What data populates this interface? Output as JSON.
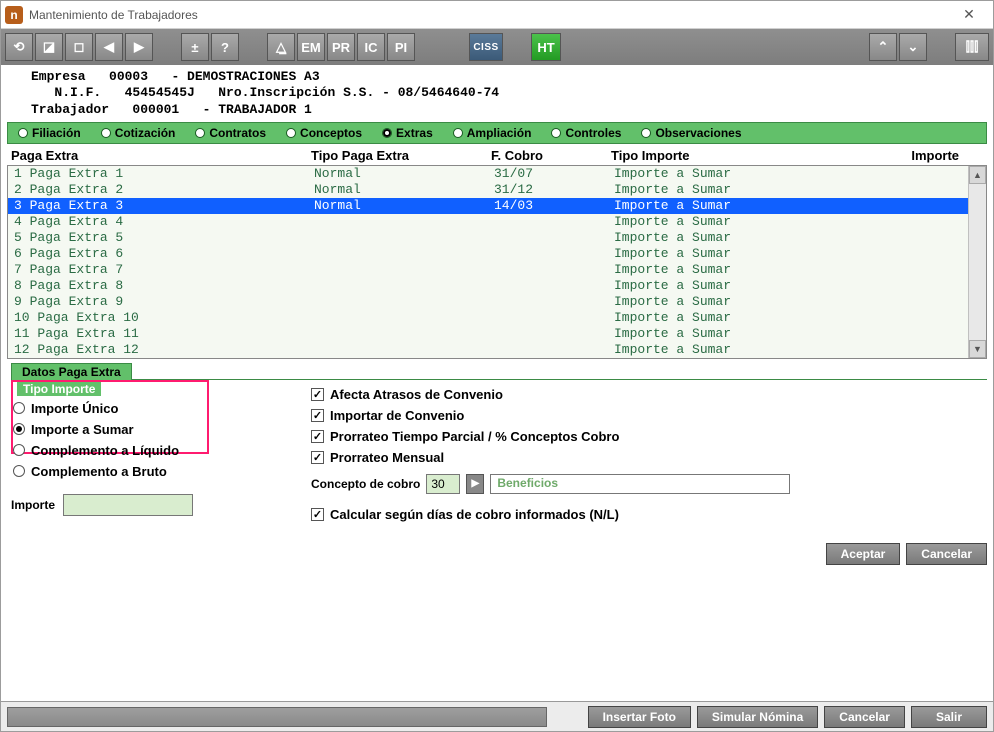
{
  "window": {
    "title": "Mantenimiento de Trabajadores",
    "app_icon_letter": "n"
  },
  "toolbar": {
    "refresh": "⟲",
    "max": "◪",
    "stop": "◻",
    "prev": "◀",
    "next": "▶",
    "plus": "±",
    "help": "?",
    "bell": "△̲",
    "em": "EM",
    "pr": "PR",
    "ic": "IC",
    "pi": "PI",
    "ciss": "CISS",
    "ht": "HT",
    "up": "⌃",
    "down": "⌄",
    "eq": "⫿⫿⫿"
  },
  "info": {
    "empresa_label": "Empresa",
    "empresa_code": "00003",
    "empresa_name": "- DEMOSTRACIONES A3",
    "nif_label": "N.I.F.",
    "nif": "45454545J",
    "inscrip_label": "Nro.Inscripción S.S.",
    "inscrip": "- 08/5464640-74",
    "trab_label": "Trabajador",
    "trab_code": "000001",
    "trab_name": "- TRABAJADOR 1"
  },
  "tabs": [
    "Filiación",
    "Cotización",
    "Contratos",
    "Conceptos",
    "Extras",
    "Ampliación",
    "Controles",
    "Observaciones"
  ],
  "active_tab": 4,
  "list_headers": [
    "Paga Extra",
    "Tipo Paga Extra",
    "F. Cobro",
    "Tipo Importe",
    "Importe"
  ],
  "rows": [
    {
      "n": "1",
      "name": "Paga Extra 1",
      "tipo": "Normal",
      "f": "31/07",
      "ti": "Importe a Sumar"
    },
    {
      "n": "2",
      "name": "Paga Extra 2",
      "tipo": "Normal",
      "f": "31/12",
      "ti": "Importe a Sumar"
    },
    {
      "n": "3",
      "name": "Paga Extra 3",
      "tipo": "Normal",
      "f": "14/03",
      "ti": "Importe a Sumar",
      "selected": true
    },
    {
      "n": "4",
      "name": "Paga Extra 4",
      "tipo": "",
      "f": "",
      "ti": "Importe a Sumar"
    },
    {
      "n": "5",
      "name": "Paga Extra 5",
      "tipo": "",
      "f": "",
      "ti": "Importe a Sumar"
    },
    {
      "n": "6",
      "name": "Paga Extra 6",
      "tipo": "",
      "f": "",
      "ti": "Importe a Sumar"
    },
    {
      "n": "7",
      "name": "Paga Extra 7",
      "tipo": "",
      "f": "",
      "ti": "Importe a Sumar"
    },
    {
      "n": "8",
      "name": "Paga Extra 8",
      "tipo": "",
      "f": "",
      "ti": "Importe a Sumar"
    },
    {
      "n": "9",
      "name": "Paga Extra 9",
      "tipo": "",
      "f": "",
      "ti": "Importe a Sumar"
    },
    {
      "n": "10",
      "name": "Paga Extra 10",
      "tipo": "",
      "f": "",
      "ti": "Importe a Sumar"
    },
    {
      "n": "11",
      "name": "Paga Extra 11",
      "tipo": "",
      "f": "",
      "ti": "Importe a Sumar"
    },
    {
      "n": "12",
      "name": "Paga Extra 12",
      "tipo": "",
      "f": "",
      "ti": "Importe a Sumar"
    }
  ],
  "group_label": "Datos Paga Extra",
  "tipo_importe": {
    "legend": "Tipo Importe",
    "options": [
      "Importe Único",
      "Importe a Sumar",
      "Complemento a Líquido",
      "Complemento a Bruto"
    ],
    "selected": 1
  },
  "importe_label": "Importe",
  "checks": {
    "afecta": "Afecta Atrasos de Convenio",
    "importar": "Importar de Convenio",
    "prorrateo_tp": "Prorrateo Tiempo Parcial / % Conceptos Cobro",
    "prorrateo_m": "Prorrateo Mensual",
    "calcular": "Calcular según días de cobro informados (N/L)"
  },
  "concepto": {
    "label": "Concepto de cobro",
    "value": "30",
    "text": "Beneficios"
  },
  "inner_buttons": {
    "aceptar": "Aceptar",
    "cancelar": "Cancelar"
  },
  "bottom": {
    "insertar": "Insertar Foto",
    "simular": "Simular Nómina",
    "cancelar": "Cancelar",
    "salir": "Salir"
  }
}
